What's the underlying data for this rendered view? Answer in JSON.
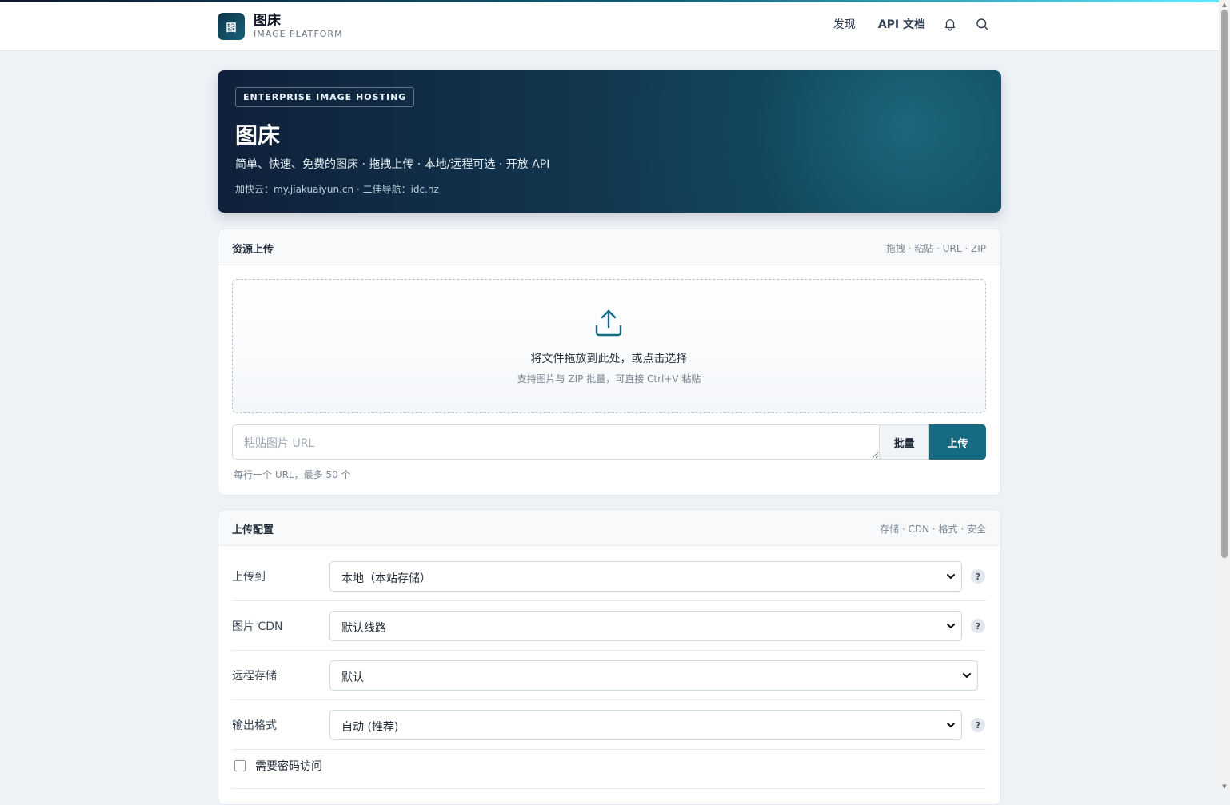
{
  "brand": {
    "logo_char": "图",
    "name": "图床",
    "subtitle": "IMAGE PLATFORM"
  },
  "nav": {
    "discover": "发现",
    "api_docs": "API 文档",
    "icons": [
      "bell-icon",
      "search-icon"
    ]
  },
  "hero": {
    "tag": "ENTERPRISE IMAGE HOSTING",
    "title": "图床",
    "description": "简单、快速、免费的图床 · 拖拽上传 · 本地/远程可选 · 开放 API",
    "links": "加快云：my.jiakuaiyun.cn · 二佳导航：idc.nz"
  },
  "upload_card": {
    "title": "资源上传",
    "meta": "拖拽 · 粘贴 · URL · ZIP",
    "drop_main": "将文件拖放到此处，或点击选择",
    "drop_sub": "支持图片与 ZIP 批量，可直接 Ctrl+V 粘贴",
    "url_placeholder": "粘贴图片 URL",
    "batch_label": "批量",
    "upload_label": "上传",
    "hint": "每行一个 URL，最多 50 个"
  },
  "config_card": {
    "title": "上传配置",
    "meta": "存储 · CDN · 格式 · 安全",
    "rows": [
      {
        "label": "上传到",
        "value": "本地（本站存储）",
        "help": "?"
      },
      {
        "label": "图片 CDN",
        "value": "默认线路",
        "help": "?"
      },
      {
        "label": "远程存储",
        "value": "默认"
      },
      {
        "label": "输出格式",
        "value": "自动 (推荐)",
        "help": "?"
      }
    ],
    "password_label": "需要密码访问",
    "password_checked": false
  },
  "colors": {
    "accent": "#166a82",
    "hero_dark": "#10203a",
    "page_bg": "#eef2f6"
  }
}
